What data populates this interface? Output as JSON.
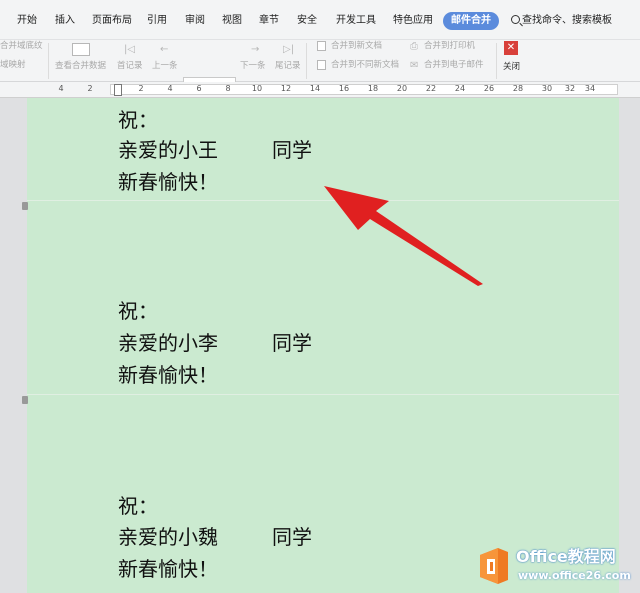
{
  "tabs": [
    {
      "label": "开始"
    },
    {
      "label": "插入"
    },
    {
      "label": "页面布局"
    },
    {
      "label": "引用"
    },
    {
      "label": "审阅"
    },
    {
      "label": "视图"
    },
    {
      "label": "章节"
    },
    {
      "label": "安全"
    },
    {
      "label": "开发工具"
    },
    {
      "label": "特色应用"
    },
    {
      "label": "邮件合并"
    }
  ],
  "active_tab": "邮件合并",
  "search_label": "查找命令、搜索模板",
  "toolbar": {
    "merge_field_partial": "合并域底纹",
    "field_map_partial": "域映射",
    "view_merge_data": "查看合并数据",
    "first_record": "首记录",
    "prev_record": "上一条",
    "record_value": "",
    "next_record": "下一条",
    "last_record": "尾记录",
    "merge_to_new_doc": "合并到新文档",
    "merge_to_diff_docs": "合并到不同新文档",
    "merge_to_printer": "合并到打印机",
    "merge_to_email": "合并到电子邮件",
    "close": "关闭"
  },
  "ruler": {
    "numbers": [
      "4",
      "2",
      "2",
      "4",
      "6",
      "8",
      "10",
      "12",
      "14",
      "16",
      "18",
      "20",
      "22",
      "24",
      "26",
      "28",
      "30",
      "32",
      "34"
    ]
  },
  "document": {
    "cards": [
      {
        "wish": "祝：",
        "name": "亲爱的小王",
        "classmate": "同学",
        "greeting": "新春愉快！"
      },
      {
        "wish": "祝：",
        "name": "亲爱的小李",
        "classmate": "同学",
        "greeting": "新春愉快！"
      },
      {
        "wish": "祝：",
        "name": "亲爱的小魏",
        "classmate": "同学",
        "greeting": "新春愉快！"
      }
    ]
  },
  "watermark": {
    "name": "Office教程网",
    "url": "www.office26.com"
  },
  "colors": {
    "page_background": "#cbead0",
    "active_tab": "#5b8bdc",
    "arrow": "#e02020",
    "logo_orange": "#ef7a23",
    "close_button": "#d8403a"
  }
}
